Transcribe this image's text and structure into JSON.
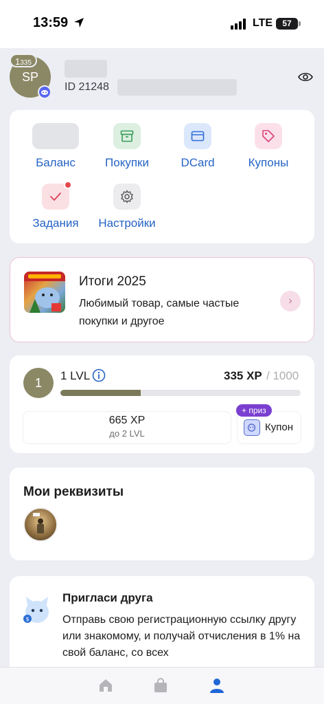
{
  "status_bar": {
    "time": "13:59",
    "network": "LTE",
    "battery": "57"
  },
  "profile": {
    "initials": "SP",
    "level": "1",
    "xp_small": "335",
    "id_label": "ID 21248"
  },
  "menu": {
    "items": [
      {
        "label": "Баланс",
        "icon": "balance-icon"
      },
      {
        "label": "Покупки",
        "icon": "archive-icon"
      },
      {
        "label": "DCard",
        "icon": "card-icon"
      },
      {
        "label": "Купоны",
        "icon": "tag-icon"
      },
      {
        "label": "Задания",
        "icon": "check-icon"
      },
      {
        "label": "Настройки",
        "icon": "gear-icon"
      }
    ]
  },
  "results": {
    "title": "Итоги 2025",
    "description": "Любимый товар, самые частые покупки и другое"
  },
  "level": {
    "circle": "1",
    "label": "1 LVL",
    "xp_current": "335 XP",
    "xp_total": "/ 1000",
    "progress": 0.335,
    "remaining_xp": "665 XP",
    "next_level": "до 2 LVL",
    "prize_badge": "+ приз",
    "prize_label": "Купон"
  },
  "requisites": {
    "title": "Мои реквизиты"
  },
  "invite": {
    "title": "Пригласи друга",
    "text": "Отправь свою регистрационную ссылку другу или знакомому, и получай отчисления в 1% на свой баланс, со всех"
  },
  "colors": {
    "accent": "#2563c4",
    "level": "#8b8866",
    "prize": "#7a3fd1",
    "active_tab": "#1f66d6"
  },
  "tabs": [
    {
      "icon": "home-icon",
      "active": false
    },
    {
      "icon": "bag-icon",
      "active": false
    },
    {
      "icon": "profile-icon",
      "active": true
    }
  ]
}
